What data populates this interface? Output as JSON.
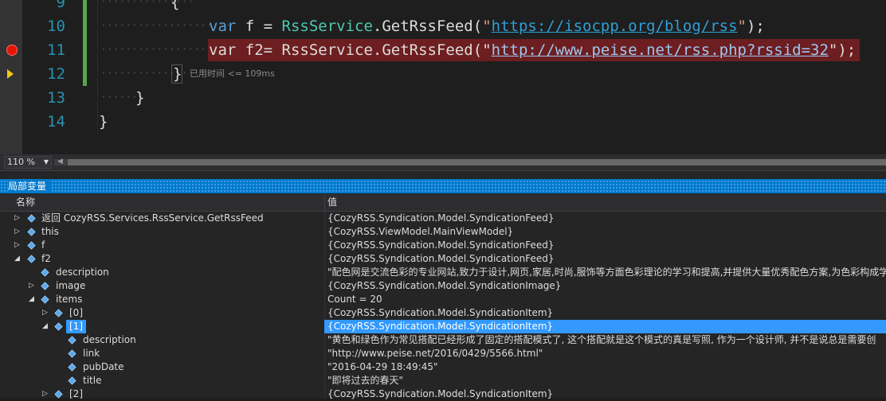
{
  "editor": {
    "lines": [
      {
        "num": "9"
      },
      {
        "num": "10"
      },
      {
        "num": "11"
      },
      {
        "num": "12"
      },
      {
        "num": "13"
      },
      {
        "num": "14"
      }
    ],
    "line9_brace": "{",
    "line10": {
      "kw": "var",
      "rest1": " f = ",
      "type": "RssService",
      "rest2": ".GetRssFeed(",
      "q1": "\"",
      "url": "https://isocpp.org/blog/rss",
      "q2": "\"",
      "end": ");"
    },
    "line11": {
      "kw": "var",
      "rest1": " f2= ",
      "type": "RssService",
      "rest2": ".GetRssFeed(",
      "q1": "\"",
      "url": "http://www.peise.net/rss.php?rssid=32",
      "q2": "\"",
      "end": ");"
    },
    "line12_brace": "}",
    "elapsed": "已用时间 <= 109ms",
    "line13_brace": "}",
    "line14_brace": "}"
  },
  "zoom": {
    "value": "110 %"
  },
  "locals": {
    "title": "局部变量",
    "col_name": "名称",
    "col_value": "值",
    "rows": [
      {
        "name": "返回 CozyRSS.Services.RssService.GetRssFeed",
        "value": "{CozyRSS.Syndication.Model.SyndicationFeed}"
      },
      {
        "name": "this",
        "value": "{CozyRSS.ViewModel.MainViewModel}"
      },
      {
        "name": "f",
        "value": "{CozyRSS.Syndication.Model.SyndicationFeed}"
      },
      {
        "name": "f2",
        "value": "{CozyRSS.Syndication.Model.SyndicationFeed}"
      },
      {
        "name": "description",
        "value": "\"配色网是交流色彩的专业网站,致力于设计,网页,家居,时尚,服饰等方面色彩理论的学习和提高,并提供大量优秀配色方案,为色彩构成学习"
      },
      {
        "name": "image",
        "value": "{CozyRSS.Syndication.Model.SyndicationImage}"
      },
      {
        "name": "items",
        "value": "Count = 20"
      },
      {
        "name": "[0]",
        "value": "{CozyRSS.Syndication.Model.SyndicationItem}"
      },
      {
        "name": "[1]",
        "value": "{CozyRSS.Syndication.Model.SyndicationItem}"
      },
      {
        "name": "description",
        "value": "\"黄色和绿色作为常见搭配已经形成了固定的搭配模式了, 这个搭配就是这个模式的真是写照, 作为一个设计师, 并不是说总是需要创"
      },
      {
        "name": "link",
        "value": "\"http://www.peise.net/2016/0429/5566.html\""
      },
      {
        "name": "pubDate",
        "value": "\"2016-04-29 18:49:45\""
      },
      {
        "name": "title",
        "value": "\"即将过去的春天\""
      },
      {
        "name": "[2]",
        "value": "{CozyRSS.Syndication.Model.SyndicationItem}"
      }
    ]
  }
}
